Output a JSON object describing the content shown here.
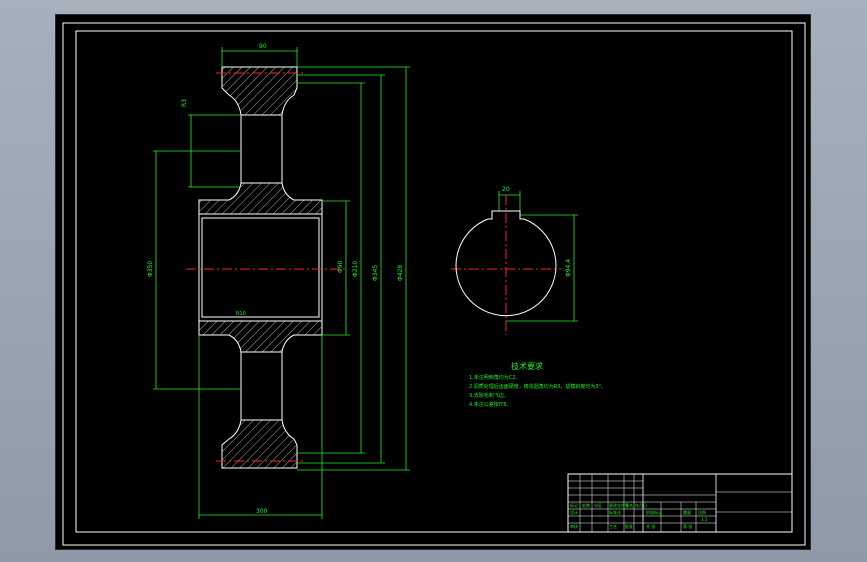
{
  "dimensions": {
    "top_width": "90",
    "bottom_width": "300",
    "rim_chamfer": "R3",
    "hub_dia": "Φ350",
    "bore_dia": "Φ90",
    "bore_dia2": "Φ210",
    "pitch_dia": "Φ345",
    "root_dia": "Φ416",
    "outer_dia": "Φ428",
    "keyway_width": "20",
    "keyway_depth": "Φ94.4",
    "web_note": "R10",
    "rim_note": "5×45°"
  },
  "tech_requirements": {
    "title": "技术要求",
    "lines": [
      "1.未注明倒角均为C2。",
      "2.调质处理后齿面硬度，铸造圆角均为R3，拔模斜度均为3°。",
      "3.去除毛刺飞边。",
      "4.未注公差按IT8。"
    ]
  },
  "title_block": {
    "row_labels": [
      "标记",
      "处数",
      "分区",
      "更改文件号",
      "签名",
      "年月日"
    ],
    "design": "设计",
    "standard": "标准化",
    "stage": "阶段标记",
    "weight": "重量",
    "ratio": "比例",
    "ratio_value": "1:1",
    "sheet": "共 张",
    "sheet2": "第 张",
    "approve": "审核",
    "process": "工艺",
    "approve2": "批准"
  },
  "colors": {
    "background": "#000000",
    "frame": "#ffffff",
    "dimension": "#22ee22",
    "centerline": "#ff2020",
    "outline": "#ffffff"
  }
}
